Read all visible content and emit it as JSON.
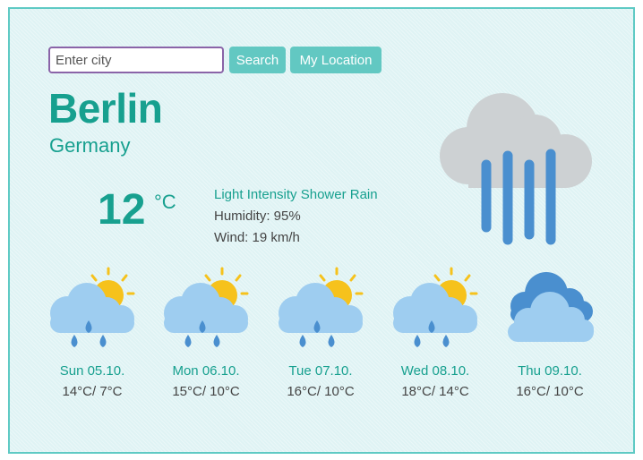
{
  "search": {
    "placeholder": "Enter city",
    "value": "",
    "search_label": "Search",
    "location_label": "My Location"
  },
  "current": {
    "city": "Berlin",
    "country": "Germany",
    "temperature": "12",
    "unit": "°C",
    "description": "Light Intensity Shower Rain",
    "humidity": "Humidity: 95%",
    "wind": "Wind: 19 km/h",
    "icon": "cloud-rain-icon"
  },
  "forecast": [
    {
      "label": "Sun 05.10.",
      "range": "14°C/ 7°C",
      "icon": "sun-cloud-rain-icon"
    },
    {
      "label": "Mon 06.10.",
      "range": "15°C/ 10°C",
      "icon": "sun-cloud-rain-icon"
    },
    {
      "label": "Tue 07.10.",
      "range": "16°C/ 10°C",
      "icon": "sun-cloud-rain-icon"
    },
    {
      "label": "Wed 08.10.",
      "range": "18°C/ 14°C",
      "icon": "sun-cloud-rain-icon"
    },
    {
      "label": "Thu 09.10.",
      "range": "16°C/ 10°C",
      "icon": "clouds-icon"
    }
  ],
  "colors": {
    "accent": "#17a08f",
    "button": "#62c8c2",
    "background": "#dff3f4",
    "rain": "#4a8fcf",
    "sun": "#f6c21c",
    "cloud_light": "#9ecdf0",
    "cloud_grey": "#cdd1d3"
  }
}
